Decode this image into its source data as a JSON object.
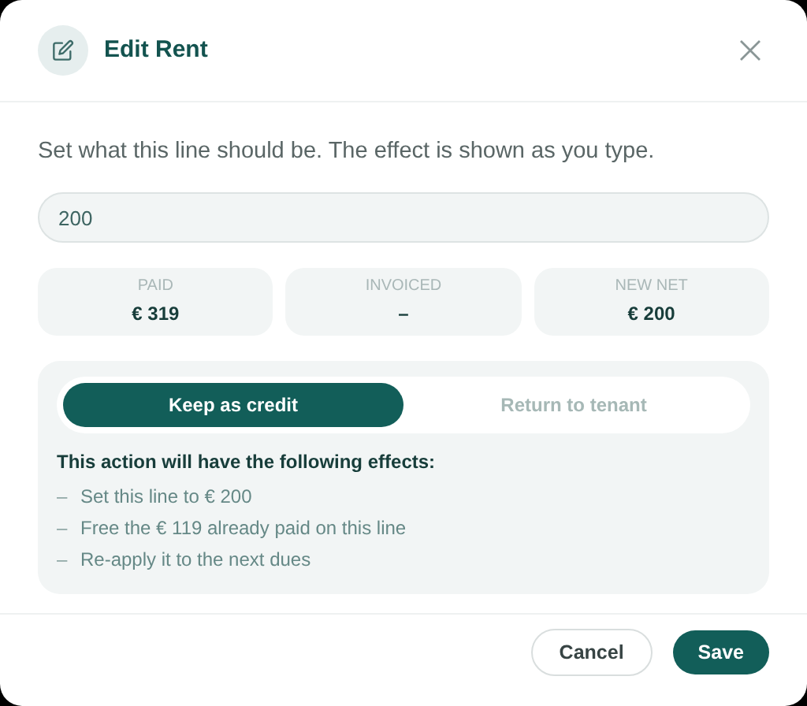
{
  "dialog": {
    "title": "Edit Rent",
    "description": "Set what this line should be. The effect is shown as you type.",
    "amount_field": {
      "value": "200"
    },
    "stats": [
      {
        "label": "PAID",
        "value": "€ 319"
      },
      {
        "label": "INVOICED",
        "value": "–"
      },
      {
        "label": "NEW NET",
        "value": "€ 200"
      }
    ],
    "options": [
      {
        "label": "Keep as credit",
        "selected": true
      },
      {
        "label": "Return to tenant",
        "selected": false
      }
    ],
    "effects_title": "This action will have the following effects:",
    "effects": [
      {
        "marker": "–",
        "text": "Set this line to € 200"
      },
      {
        "marker": "–",
        "text": "Free the € 119 already paid on this line"
      },
      {
        "marker": "–",
        "text": "Re-apply it to the next dues"
      }
    ],
    "buttons": [
      {
        "label": "Cancel",
        "kind": "secondary"
      },
      {
        "label": "Save",
        "kind": "primary"
      }
    ]
  }
}
